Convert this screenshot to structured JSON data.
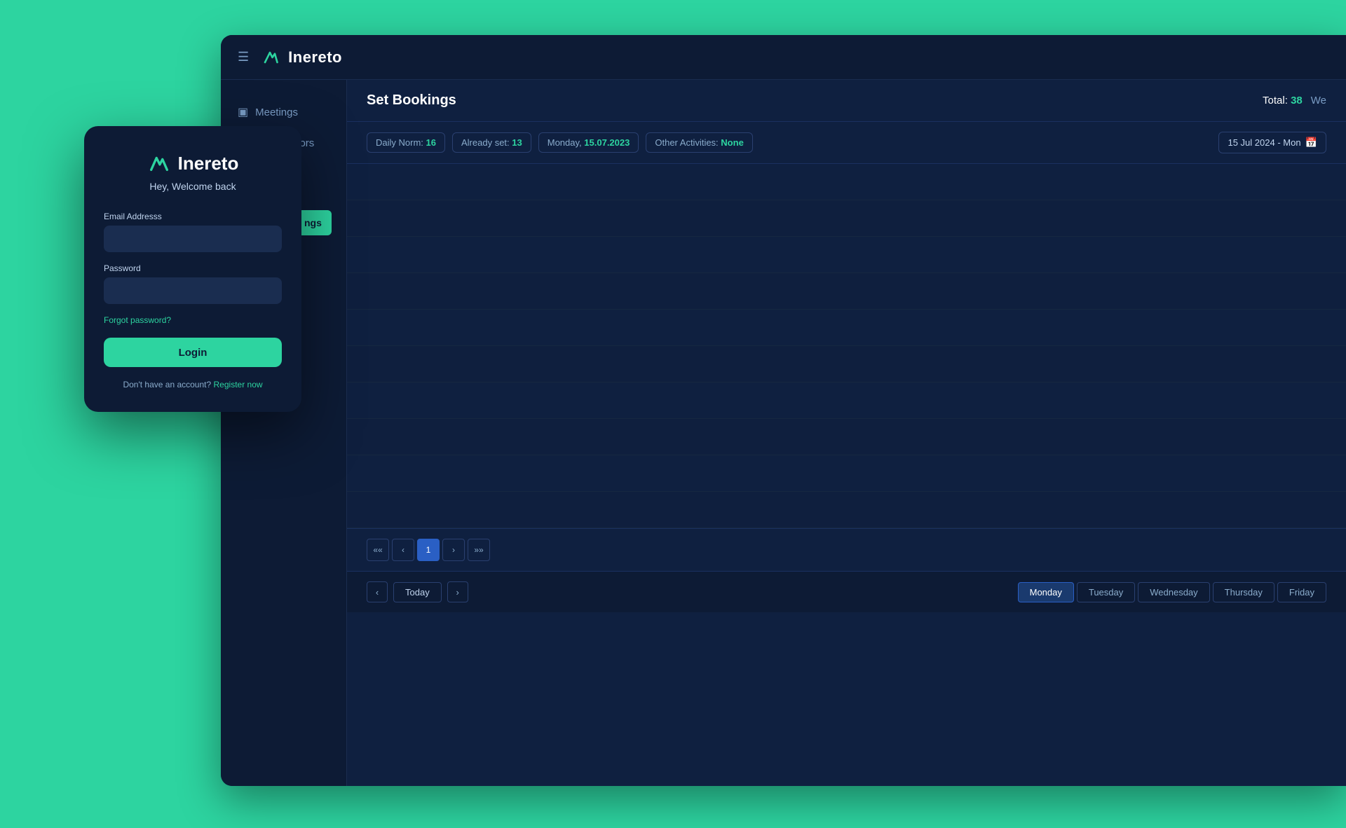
{
  "app": {
    "brand": "Inereto",
    "nav_items": [
      {
        "id": "meetings",
        "label": "Meetings",
        "icon": "📅"
      },
      {
        "id": "collaborators",
        "label": "Colaborators",
        "icon": "👥"
      }
    ]
  },
  "bookings": {
    "page_title": "Set Bookings",
    "total_label": "Total:",
    "total_count": "38",
    "we_label": "We",
    "filters": [
      {
        "id": "daily-norm",
        "label": "Daily Norm:",
        "value": "16"
      },
      {
        "id": "already-set",
        "label": "Already set:",
        "value": "13"
      },
      {
        "id": "monday",
        "label": "Monday,",
        "value": "15.07.2023"
      },
      {
        "id": "other-activities",
        "label": "Other Activities:",
        "value": "None"
      }
    ],
    "date_selector": "15 Jul 2024 - Mon",
    "pagination": {
      "first": "««",
      "prev": "‹",
      "current": "1",
      "next": "›",
      "last": "»»"
    },
    "day_nav": {
      "prev_arrow": "‹",
      "next_arrow": "›",
      "today": "Today",
      "days": [
        "Monday",
        "Tuesday",
        "Wednesday",
        "Thursday",
        "Friday"
      ],
      "active_day": "Monday"
    }
  },
  "login": {
    "brand": "Inereto",
    "welcome": "Hey, Welcome back",
    "email_label": "Email Addresss",
    "email_placeholder": "",
    "password_label": "Password",
    "password_placeholder": "",
    "forgot_password": "Forgot password?",
    "login_button": "Login",
    "no_account_text": "Don't have an account?",
    "register_link": "Register now"
  },
  "partial_tab": "ngs",
  "thursday_text": "Thursday"
}
